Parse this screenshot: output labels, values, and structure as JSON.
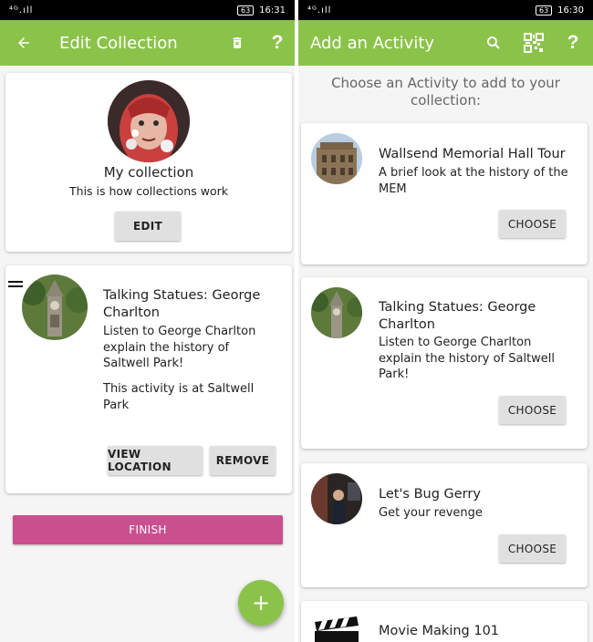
{
  "left": {
    "status": {
      "signal": "⁴ᴳ.ıll",
      "battery": "63",
      "time": "16:31"
    },
    "appbar": {
      "title": "Edit Collection"
    },
    "collection": {
      "name": "My collection",
      "description": "This is how collections work",
      "edit_label": "EDIT"
    },
    "activity": {
      "title": "Talking Statues: George Charlton",
      "description": "Listen to George Charlton explain the history of Saltwell Park!",
      "location_text": "This activity is at Saltwell Park",
      "view_location_label": "VIEW LOCATION",
      "remove_label": "REMOVE"
    },
    "finish_label": "FINISH",
    "fab_label": "+"
  },
  "right": {
    "status": {
      "signal": "⁴ᴳ.ıll",
      "battery": "63",
      "time": "16:30"
    },
    "appbar": {
      "title": "Add an Activity"
    },
    "prompt": "Choose an Activity to add to your collection:",
    "activities": [
      {
        "title": "Wallsend Memorial Hall Tour",
        "description": "A brief look at the history of the MEM",
        "choose_label": "CHOOSE"
      },
      {
        "title": "Talking Statues: George Charlton",
        "description": "Listen to George Charlton explain the history of Saltwell Park!",
        "choose_label": "CHOOSE"
      },
      {
        "title": "Let's Bug Gerry",
        "description": "Get your revenge",
        "choose_label": "CHOOSE"
      },
      {
        "title": "Movie Making 101"
      }
    ]
  },
  "colors": {
    "appbar": "#8bc34a",
    "finish": "#c94f8f",
    "fab": "#8bc34a"
  },
  "icons": [
    "back-arrow-icon",
    "delete-icon",
    "help-icon",
    "search-icon",
    "qr-code-icon",
    "drag-handle-icon",
    "add-icon"
  ]
}
